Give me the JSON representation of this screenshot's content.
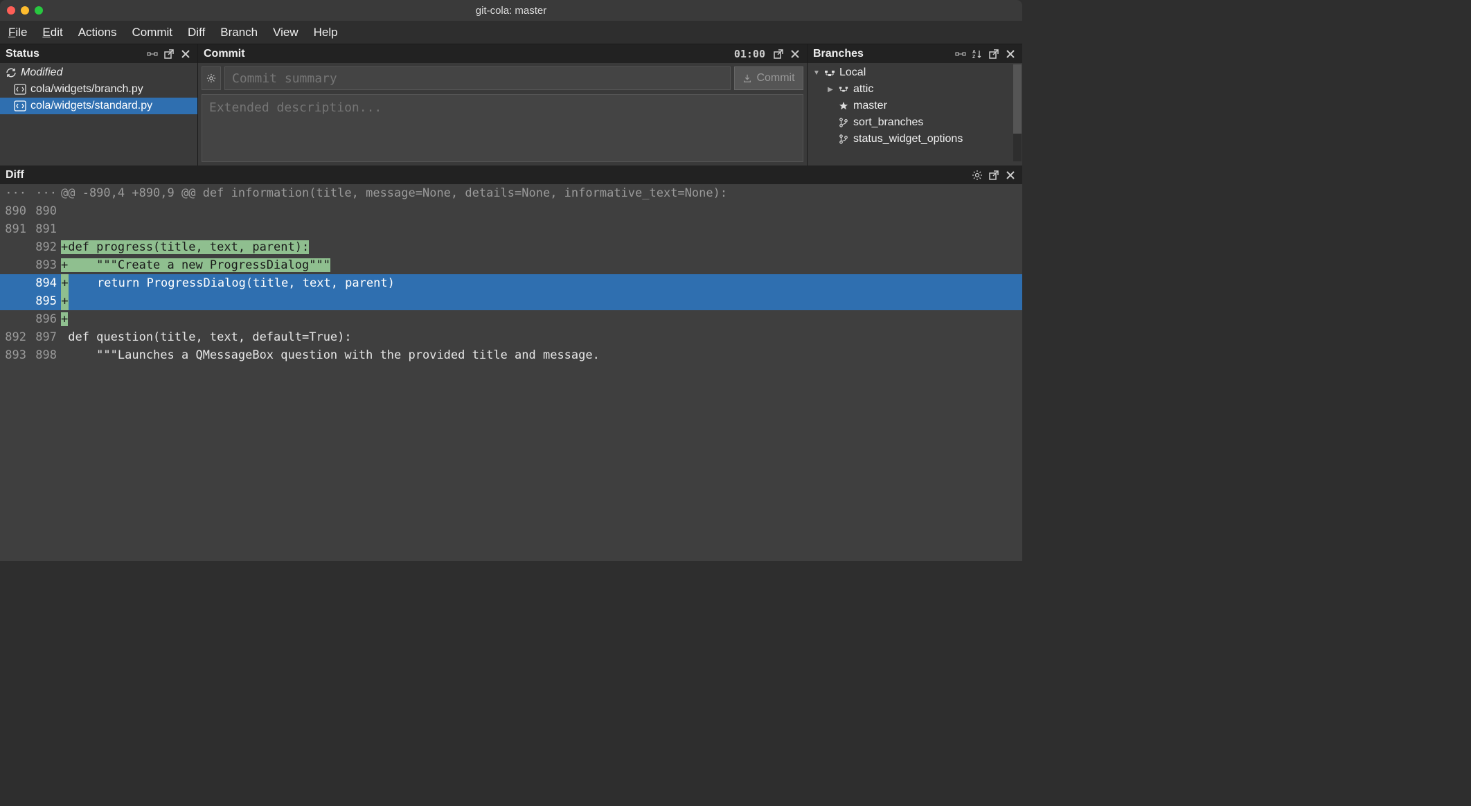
{
  "window": {
    "title": "git-cola: master"
  },
  "menubar": {
    "file": "File",
    "edit": "Edit",
    "actions": "Actions",
    "commit": "Commit",
    "diff": "Diff",
    "branch": "Branch",
    "view": "View",
    "help": "Help"
  },
  "status": {
    "title": "Status",
    "section": "Modified",
    "items": [
      {
        "path": "cola/widgets/branch.py",
        "selected": false
      },
      {
        "path": "cola/widgets/standard.py",
        "selected": true
      }
    ]
  },
  "commit": {
    "title": "Commit",
    "timer": "01:00",
    "summary_placeholder": "Commit summary",
    "description_placeholder": "Extended description...",
    "commit_label": "Commit"
  },
  "branches": {
    "title": "Branches",
    "root": "Local",
    "items": [
      {
        "name": "attic",
        "icon": "folder",
        "expandable": true
      },
      {
        "name": "master",
        "icon": "star",
        "expandable": false
      },
      {
        "name": "sort_branches",
        "icon": "branch",
        "expandable": false
      },
      {
        "name": "status_widget_options",
        "icon": "branch",
        "expandable": false
      }
    ]
  },
  "diff": {
    "title": "Diff",
    "lines": [
      {
        "old": "···",
        "new": "···",
        "type": "hunk",
        "text": "@@ -890,4 +890,9 @@ def information(title, message=None, details=None, informative_text=None):"
      },
      {
        "old": "890",
        "new": "890",
        "type": "ctx",
        "text": ""
      },
      {
        "old": "891",
        "new": "891",
        "type": "ctx",
        "text": ""
      },
      {
        "old": "",
        "new": "892",
        "type": "add",
        "text": "def progress(title, text, parent):",
        "selected": false
      },
      {
        "old": "",
        "new": "893",
        "type": "add",
        "text": "    \"\"\"Create a new ProgressDialog\"\"\"",
        "selected": false
      },
      {
        "old": "",
        "new": "894",
        "type": "add",
        "text": "    return ProgressDialog(title, text, parent)",
        "selected": true
      },
      {
        "old": "",
        "new": "895",
        "type": "add",
        "text": "",
        "selected": true
      },
      {
        "old": "",
        "new": "896",
        "type": "add",
        "text": "",
        "selected": false
      },
      {
        "old": "892",
        "new": "897",
        "type": "ctx",
        "text": " def question(title, text, default=True):"
      },
      {
        "old": "893",
        "new": "898",
        "type": "ctx",
        "text": "     \"\"\"Launches a QMessageBox question with the provided title and message."
      }
    ]
  }
}
